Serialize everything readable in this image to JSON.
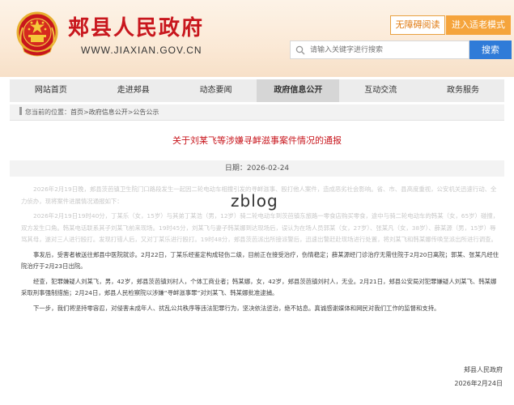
{
  "header": {
    "site_title": "郏县人民政府",
    "site_url": "WWW.JIAXIAN.GOV.CN",
    "accessibility_label": "无障碍阅读",
    "elderly_label": "进入适老模式",
    "search_placeholder": "请输入关键字进行搜索",
    "search_button": "搜索"
  },
  "nav": {
    "items": [
      {
        "label": "网站首页"
      },
      {
        "label": "走进郏县"
      },
      {
        "label": "动态要闻"
      },
      {
        "label": "政府信息公开"
      },
      {
        "label": "互动交流"
      },
      {
        "label": "政务服务"
      }
    ],
    "active_index": 3
  },
  "breadcrumb": {
    "prefix": "您当前的位置：",
    "home": "首页",
    "sep1": ">",
    "section": "政府信息公开",
    "sep2": ">",
    "current": "公告公示"
  },
  "article": {
    "title": "关于刘某飞等涉嫌寻衅滋事案件情况的通报",
    "date": "日期：2026-02-24",
    "paragraphs": [
      "2026年2月19日晚，郏县茨芭镇卫生院门口路段发生一起因二轮电动车相撞引发的寻衅滋事、殴打他人案件，造成恶劣社会影响。省、市、县高度重视，公安机关迅速行动、全力侦办，现将案件进展情况通报如下：",
      "2026年2月19日19时40分，丁某乐（女，15岁）与其弟丁某浩（男，12岁）骑二轮电动车到茨芭镇东旅路一零食店购买零食，途中与骑二轮电动车的韩某（女，65岁）碰撞，双方发生口角。韩某电话联系其子刘某飞前来现场。19时45分，刘某飞与妻子韩某娜到达现场后，误认为在场人员郭某（女，27岁）、张某凡（女，38岁）、薛某源（男，15岁）辱骂其母，遂对三人进行殴打。发现打错人后，又对丁某乐进行殴打。19时48分，郏县茨芭派出所接派警后，迅速出警赶赴现场进行处置，将刘某飞和韩某娜传唤至派出所进行调查。",
      "事发后，受害者被送往郏县中医院就诊。2月22日，丁某乐经鉴定构成轻伤二级，目前正在接受治疗，伤情稳定；薛某源经门诊治疗无需住院于2月20日离院；郭某、张某凡经住院治疗于2月23日出院。",
      "经查，犯罪嫌疑人刘某飞，男，42岁，郏县茨芭镇刘村人，个体工商业者；韩某娜，女，42岁，郏县茨芭镇刘村人，无业。2月21日，郏县公安局对犯罪嫌疑人刘某飞、韩某娜采取刑事强制措施；2月24日，郏县人民检察院以涉嫌“寻衅滋事罪”对刘某飞、韩某娜批准逮捕。",
      "下一步，我们将坚持零容忍，对侵害未成年人、扰乱公共秩序等违法犯罪行为，坚决依法惩治，绝不姑息。真诚感谢媒体和网民对我们工作的监督和支持。"
    ],
    "watermark": "zblog",
    "signature_org": "郏县人民政府",
    "signature_date": "2026年2月24日"
  },
  "colors": {
    "brand_red": "#c8161d",
    "accent_orange": "#f5a43c",
    "search_blue": "#2f7bd8"
  }
}
